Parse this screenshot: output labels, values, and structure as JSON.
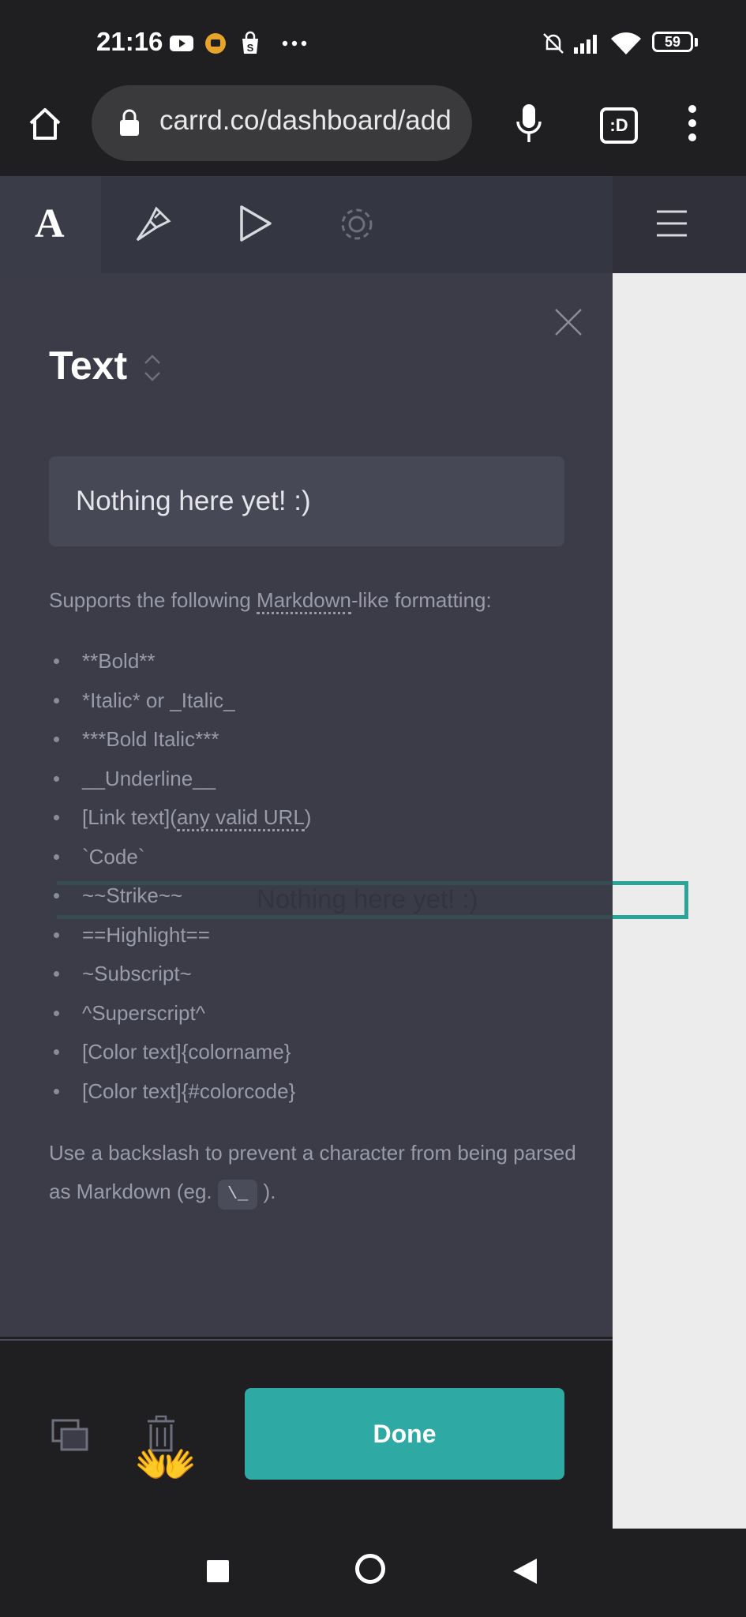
{
  "status_bar": {
    "time": "21:16",
    "icons": [
      "youtube-icon",
      "notification-icon",
      "shopping-bag-icon",
      "more-dots-icon",
      "mute-bell-icon",
      "signal-icon",
      "wifi-icon",
      "battery-icon"
    ],
    "battery_level": "59"
  },
  "browser": {
    "url": "carrd.co/dashboard/add",
    "icons": [
      "home-icon",
      "lock-icon",
      "microphone-icon",
      "tab-switcher-icon",
      "overflow-menu-icon"
    ],
    "tab_label": ":D"
  },
  "editor_toolbar": {
    "text_tool_glyph": "A",
    "tools": [
      "text-tool-icon",
      "brush-icon",
      "play-icon",
      "settings-icon",
      "hamburger-menu-icon"
    ]
  },
  "panel": {
    "title": "Text",
    "field_value": "Nothing here yet! :)",
    "help_intro_before": "Supports the following ",
    "help_intro_link": "Markdown",
    "help_intro_after": "-like formatting:",
    "formats": [
      "**Bold**",
      "*Italic* or _Italic_",
      "***Bold Italic***",
      "__Underline__",
      "[Link text](any valid URL)",
      "`Code`",
      "~~Strike~~",
      "==Highlight==",
      "~Subscript~",
      "^Superscript^",
      "[Color text]{colorname}",
      "[Color text]{#colorcode}"
    ],
    "link_item_prefix": "[Link text](",
    "link_item_link": "any valid URL",
    "link_item_suffix": ")",
    "footer_note_before": "Use a backslash to prevent a character from being parsed as Markdown (eg.",
    "footer_note_code": "\\_",
    "footer_note_after": ").",
    "done_label": "Done",
    "emoji": "👐"
  },
  "canvas": {
    "ghost_text": "Nothing here yet! :)"
  },
  "colors": {
    "accent": "#2ea9a3",
    "panel_bg": "#3b3c48",
    "toolbar_bg": "#2f303a"
  }
}
